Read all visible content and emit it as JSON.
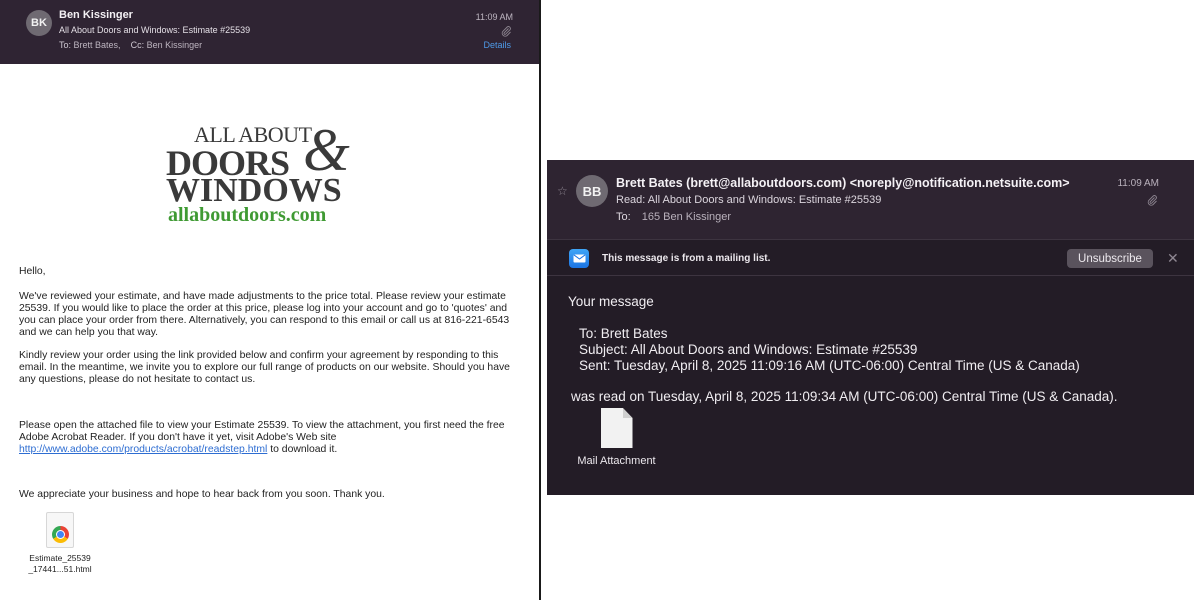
{
  "left_email": {
    "header": {
      "avatar_initials": "BK",
      "sender": "Ben Kissinger",
      "subject": "All About Doors and Windows: Estimate #25539",
      "to_label": "To:",
      "to_value": "Brett Bates,",
      "cc_label": "Cc:",
      "cc_value": "Ben Kissinger",
      "time": "11:09 AM",
      "details_label": "Details",
      "attachment_icon": "paperclip-icon"
    },
    "logo": {
      "line1": "ALL ABOUT",
      "line2": "DOORS",
      "ampersand": "&",
      "line3": "WINDOWS",
      "url": "allaboutdoors.com"
    },
    "body": {
      "greeting": "Hello,",
      "p1": "We've reviewed your estimate, and have made adjustments to the price total. Please review your estimate 25539. If you would like to place the order at this price, please log into your account and go to 'quotes' and you can place your order from there. Alternatively, you can respond to this email or call us at 816-221-6543 and we can help you that way.",
      "p2": "Kindly review your order using the link provided below and confirm your agreement by responding to this email. In the meantime, we invite you to explore our full range of products on our website. Should you have any questions, please do not hesitate to contact us.",
      "p3_before": "Please open the attached file to view your Estimate 25539. To view the attachment, you first need the free Adobe Acrobat Reader. If you don't have it yet, visit Adobe's Web site",
      "p3_link": "http://www.adobe.com/products/acrobat/readstep.html",
      "p3_after": "to download it.",
      "p4": "We appreciate your business and hope to hear back from you soon. Thank you."
    },
    "attachment": {
      "icon": "chrome-html-file-icon",
      "name_line1": "Estimate_25539",
      "name_line2": "_17441...51.html"
    }
  },
  "right_email": {
    "header": {
      "star_icon": "star-icon",
      "avatar_initials": "BB",
      "sender": "Brett Bates (brett@allaboutdoors.com) <noreply@notification.netsuite.com>",
      "subject": "Read: All About Doors and Windows: Estimate #25539",
      "to_label": "To:",
      "to_value": "165 Ben Kissinger",
      "time": "11:09 AM",
      "attachment_icon": "paperclip-icon"
    },
    "banner": {
      "icon": "mail-icon",
      "message": "This message is from a mailing list.",
      "unsubscribe_label": "Unsubscribe",
      "close_glyph": "✕"
    },
    "body": {
      "your_message": "Your message",
      "to_line": "To: Brett Bates",
      "subject_line": "Subject: All About Doors and Windows: Estimate #25539",
      "sent_line": "Sent: Tuesday, April 8, 2025 11:09:16 AM (UTC-06:00) Central Time (US & Canada)",
      "was_read_line": "was read on Tuesday, April 8, 2025 11:09:34 AM (UTC-06:00) Central Time (US & Canada).",
      "attachment_label": "Mail Attachment"
    }
  },
  "colors": {
    "header_bg": "#2f2433",
    "right_bg": "#231c26",
    "link": "#2d6dd2",
    "details_link": "#4e9ae8",
    "logo_green": "#3f9a33"
  }
}
